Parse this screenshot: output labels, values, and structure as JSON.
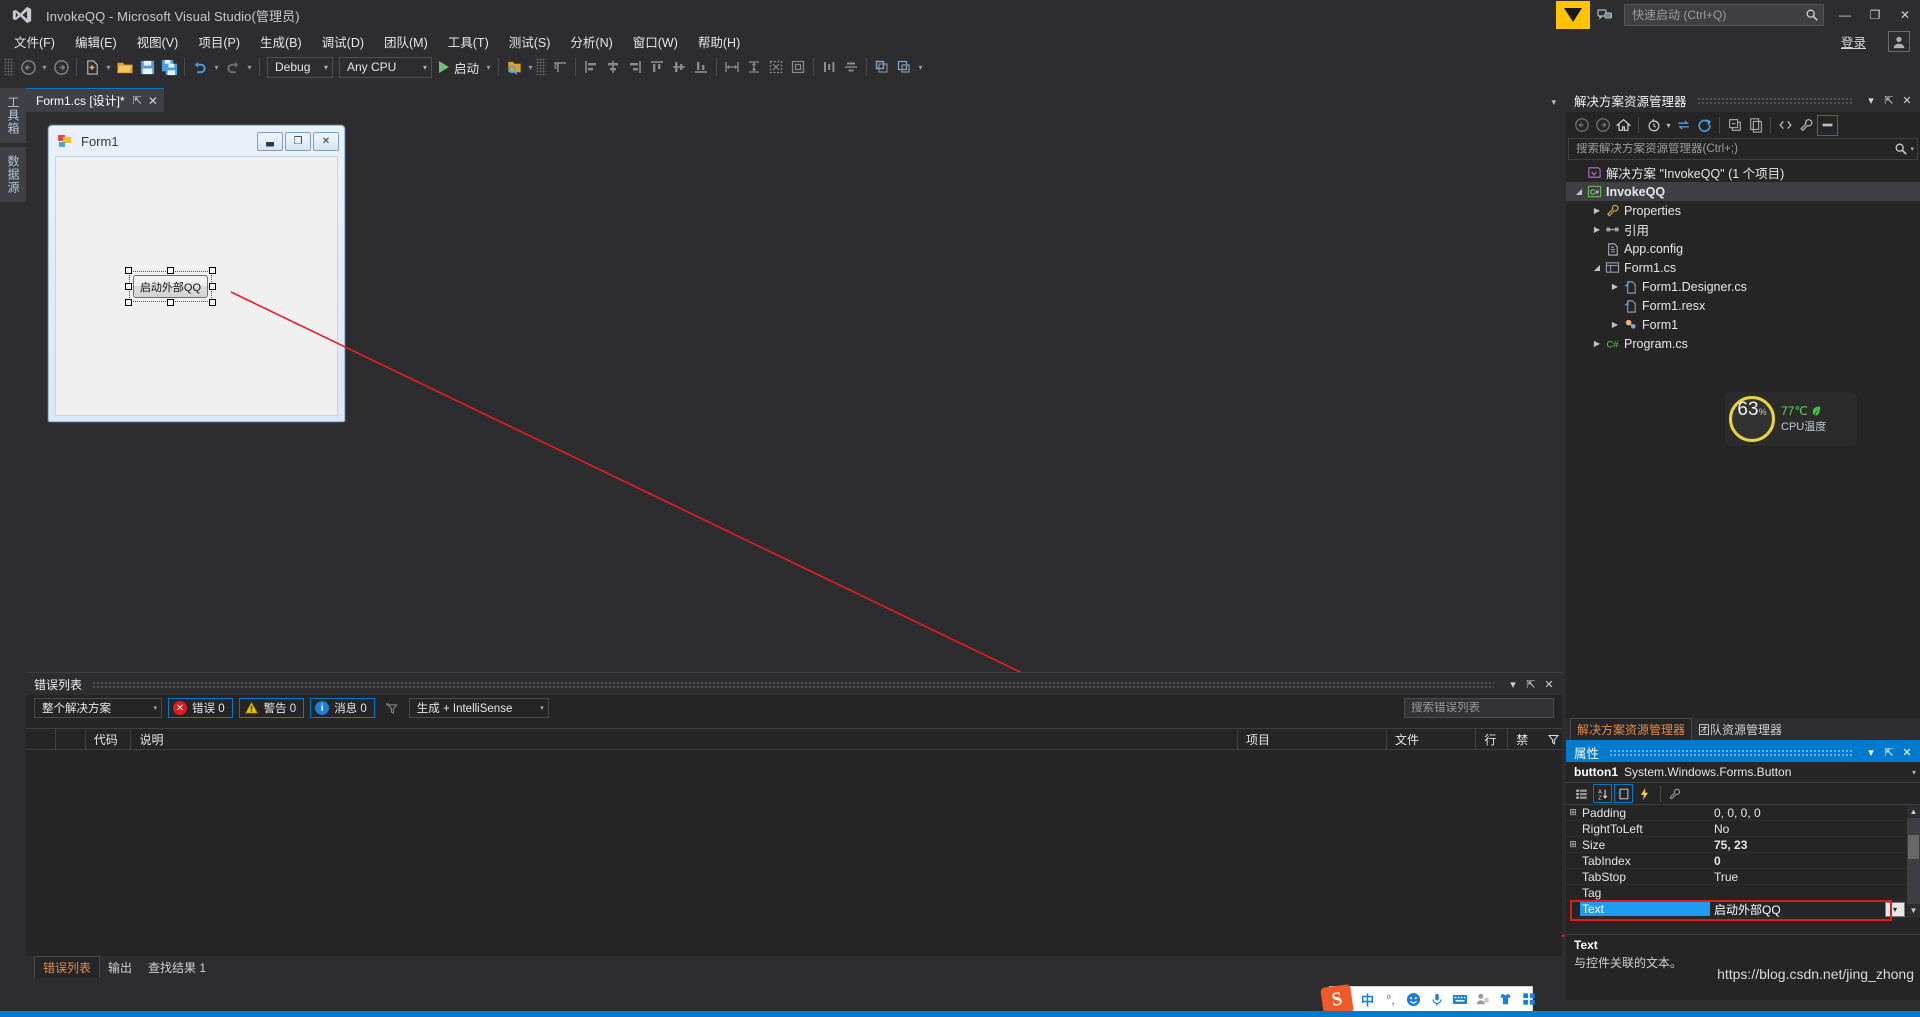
{
  "titlebar": {
    "app_title": "InvokeQQ - Microsoft Visual Studio(管理员)",
    "logo_icon": "visual-studio-logo",
    "feedback_icon": "feedback-funnel-icon",
    "speech_icon": "speech-bubble-icon",
    "quick_launch_placeholder": "快速启动 (Ctrl+Q)",
    "quick_launch_value": "",
    "search_icon": "search-icon",
    "minimize": "—",
    "restore": "❐",
    "close": "✕"
  },
  "menubar": {
    "items": [
      {
        "label": "文件(F)"
      },
      {
        "label": "编辑(E)"
      },
      {
        "label": "视图(V)"
      },
      {
        "label": "项目(P)"
      },
      {
        "label": "生成(B)"
      },
      {
        "label": "调试(D)"
      },
      {
        "label": "团队(M)"
      },
      {
        "label": "工具(T)"
      },
      {
        "label": "测试(S)"
      },
      {
        "label": "分析(N)"
      },
      {
        "label": "窗口(W)"
      },
      {
        "label": "帮助(H)"
      }
    ],
    "signin_label": "登录",
    "avatar_icon": "user-avatar-icon"
  },
  "toolbar": {
    "nav_back_icon": "navigate-back-icon",
    "nav_forward_icon": "navigate-forward-icon",
    "new_item_icon": "new-item-icon",
    "open_icon": "open-folder-icon",
    "save_icon": "save-icon",
    "save_all_icon": "save-all-icon",
    "undo_icon": "undo-icon",
    "redo_icon": "redo-icon",
    "config_value": "Debug",
    "platform_value": "Any CPU",
    "run_label": "启动",
    "run_icon": "play-triangle-icon",
    "align_icons": [
      "find-in-files-icon",
      "align-to-grid-icon",
      "align-lefts-icon",
      "align-centers-icon",
      "align-rights-icon",
      "align-tops-icon",
      "align-middles-icon",
      "align-bottoms-icon",
      "make-same-width-icon",
      "make-same-height-icon",
      "make-same-size-icon",
      "size-to-grid-icon",
      "make-horizontal-spacing-equal-icon",
      "center-horizontally-icon",
      "bring-to-front-icon",
      "send-to-back-icon"
    ]
  },
  "vertical_tabs": [
    {
      "label": "工具箱"
    },
    {
      "label": "数据源"
    }
  ],
  "document_tab": {
    "label": "Form1.cs [设计]*",
    "pin_icon": "pin-icon",
    "close_icon": "close-icon",
    "overflow_icon": "chevron-down-icon"
  },
  "designer": {
    "form": {
      "title": "Form1",
      "icon": "form-designer-icon",
      "minimize_icon": "window-minimize-icon",
      "maximize_icon": "window-maximize-icon",
      "close_icon": "window-close-icon",
      "button": {
        "text": "启动外部QQ",
        "selected": true
      }
    }
  },
  "errorlist": {
    "title": "错误列表",
    "dropdown_icon": "chevron-down-icon",
    "pin_icon": "pin-icon",
    "close_icon": "close-icon",
    "scope_value": "整个解决方案",
    "severity": [
      {
        "label": "错误 0",
        "icon": "error-icon",
        "color": "#e01b1b"
      },
      {
        "label": "警告 0",
        "icon": "warning-icon",
        "color": "#e5c100"
      },
      {
        "label": "消息 0",
        "icon": "info-icon",
        "color": "#1b7fd4"
      }
    ],
    "filter_icon": "clear-filter-icon",
    "source_value": "生成 + IntelliSense",
    "search_placeholder": "搜索错误列表",
    "search_value": "",
    "columns": [
      "",
      "",
      "代码",
      "说明",
      "项目",
      "文件",
      "行",
      "禁"
    ],
    "rows": [],
    "tabs": [
      {
        "label": "错误列表",
        "active": true
      },
      {
        "label": "输出",
        "active": false
      },
      {
        "label": "查找结果 1",
        "active": false
      }
    ]
  },
  "solution_explorer": {
    "title": "解决方案资源管理器",
    "dropdown_icon": "chevron-down-icon",
    "pin_icon": "pin-icon",
    "close_icon": "close-icon",
    "toolbar_icons": [
      "back-icon",
      "forward-icon",
      "home-icon",
      "pending-changes-icon",
      "sync-with-active-document-icon",
      "refresh-icon",
      "collapse-all-icon",
      "show-all-files-icon",
      "view-code-icon",
      "properties-wrench-icon",
      "preview-selected-items-icon"
    ],
    "search_placeholder": "搜索解决方案资源管理器(Ctrl+;)",
    "search_value": "",
    "tree": [
      {
        "label": "解决方案 \"InvokeQQ\" (1 个项目)",
        "depth": 0,
        "arrow": "",
        "icon": "solution-icon",
        "bold": false,
        "selected": false
      },
      {
        "label": "InvokeQQ",
        "depth": 0,
        "arrow": "▲",
        "icon": "csharp-project-icon",
        "bold": true,
        "selected": true
      },
      {
        "label": "Properties",
        "depth": 1,
        "arrow": "▶",
        "icon": "wrench-icon",
        "bold": false,
        "selected": false
      },
      {
        "label": "引用",
        "depth": 1,
        "arrow": "▶",
        "icon": "references-icon",
        "bold": false,
        "selected": false
      },
      {
        "label": "App.config",
        "depth": 2,
        "arrow": "",
        "icon": "config-file-icon",
        "bold": false,
        "selected": false
      },
      {
        "label": "Form1.cs",
        "depth": 1,
        "arrow": "▲",
        "icon": "form-icon",
        "bold": false,
        "selected": false
      },
      {
        "label": "Form1.Designer.cs",
        "depth": 2,
        "arrow": "▶",
        "icon": "code-file-icon",
        "bold": false,
        "selected": false
      },
      {
        "label": "Form1.resx",
        "depth": 3,
        "arrow": "",
        "icon": "resx-file-icon",
        "bold": false,
        "selected": false
      },
      {
        "label": "Form1",
        "depth": 2,
        "arrow": "▶",
        "icon": "class-icon",
        "bold": false,
        "selected": false
      },
      {
        "label": "Program.cs",
        "depth": 1,
        "arrow": "▶",
        "icon": "csharp-file-icon",
        "bold": false,
        "selected": false
      }
    ],
    "bottom_tabs": [
      {
        "label": "解决方案资源管理器",
        "active": true
      },
      {
        "label": "团队资源管理器",
        "active": false
      }
    ]
  },
  "cpu_widget": {
    "percent": "63",
    "percent_suffix": "%",
    "temperature": "77℃",
    "leaf_icon": "leaf-icon",
    "label": "CPU温度",
    "ring_color": "#e8d43c",
    "temp_color": "#5fd35f"
  },
  "properties": {
    "title": "属性",
    "dropdown_icon": "chevron-down-icon",
    "pin_icon": "pin-icon",
    "close_icon": "close-icon",
    "object_name": "button1",
    "object_type": "System.Windows.Forms.Button",
    "toolbar_icons": [
      "categorized-icon",
      "alphabetical-icon",
      "properties-page-icon",
      "events-icon",
      "property-pages-icon"
    ],
    "rows": [
      {
        "name": "Padding",
        "value": "0, 0, 0, 0",
        "expandable": true,
        "bold": false,
        "selected": false
      },
      {
        "name": "RightToLeft",
        "value": "No",
        "expandable": false,
        "bold": false,
        "selected": false
      },
      {
        "name": "Size",
        "value": "75, 23",
        "expandable": true,
        "bold": true,
        "selected": false
      },
      {
        "name": "TabIndex",
        "value": "0",
        "expandable": false,
        "bold": true,
        "selected": false
      },
      {
        "name": "TabStop",
        "value": "True",
        "expandable": false,
        "bold": false,
        "selected": false
      },
      {
        "name": "Tag",
        "value": "",
        "expandable": false,
        "bold": false,
        "selected": false
      },
      {
        "name": "Text",
        "value": "启动外部QQ",
        "expandable": false,
        "bold": false,
        "selected": true
      }
    ],
    "editor_dropdown_icon": "chevron-down-icon",
    "description_title": "Text",
    "description_text": "与控件关联的文本。",
    "scroll_up_icon": "scroll-up-icon",
    "scroll_down_icon": "scroll-down-icon"
  },
  "watermark": "https://blog.csdn.net/jing_zhong",
  "ime": {
    "logo": "S",
    "items": [
      {
        "icon": "chinese-mode-icon",
        "glyph": "中"
      },
      {
        "icon": "punctuation-icon",
        "glyph": "°,"
      },
      {
        "icon": "emoji-icon",
        "glyph": "☻"
      },
      {
        "icon": "voice-input-icon",
        "glyph": "🎤"
      },
      {
        "icon": "soft-keyboard-icon",
        "glyph": "⌨"
      },
      {
        "icon": "user-icon",
        "glyph": "👤"
      },
      {
        "icon": "skin-icon",
        "glyph": "👕"
      },
      {
        "icon": "toolbox-icon",
        "glyph": "▪▪"
      }
    ]
  },
  "colors": {
    "accent": "#007acc",
    "window_bg": "#2d2d30",
    "panel_bg": "#252526",
    "annotation_red": "#e01b1b"
  }
}
